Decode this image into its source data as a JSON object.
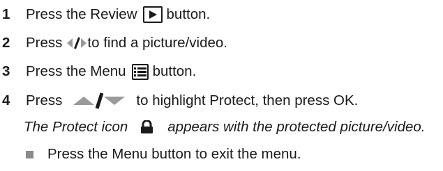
{
  "steps": [
    {
      "number": "1",
      "before": "Press the Review",
      "after": "button.",
      "icon": "play-icon"
    },
    {
      "number": "2",
      "before": "Press",
      "after": "to find a picture/video.",
      "icon": "left-right-arrows-icon"
    },
    {
      "number": "3",
      "before": "Press the Menu",
      "after": "button.",
      "icon": "menu-icon"
    },
    {
      "number": "4",
      "before": "Press",
      "after": "to highlight Protect, then press OK.",
      "icon": "up-down-arrows-icon"
    }
  ],
  "note": {
    "before": "The Protect icon",
    "after": "appears with the protected picture/video.",
    "icon": "lock-icon"
  },
  "bullet": {
    "text": "Press the Menu button to exit the menu."
  }
}
